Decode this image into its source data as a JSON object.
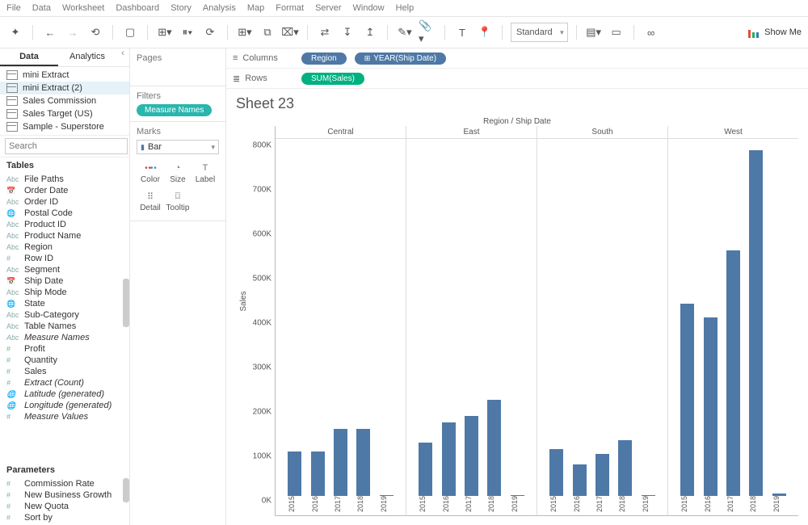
{
  "menu": [
    "File",
    "Data",
    "Worksheet",
    "Dashboard",
    "Story",
    "Analysis",
    "Map",
    "Format",
    "Server",
    "Window",
    "Help"
  ],
  "toolbar": {
    "fit": "Standard",
    "showme": "Show Me"
  },
  "left": {
    "tabs": {
      "data": "Data",
      "analytics": "Analytics"
    },
    "datasources": [
      "mini Extract",
      "mini Extract (2)",
      "Sales Commission",
      "Sales Target (US)",
      "Sample - Superstore"
    ],
    "search_placeholder": "Search",
    "tables_header": "Tables",
    "fields": [
      {
        "t": "Abc",
        "n": "File Paths"
      },
      {
        "t": "📅",
        "n": "Order Date"
      },
      {
        "t": "Abc",
        "n": "Order ID"
      },
      {
        "t": "🌐",
        "n": "Postal Code"
      },
      {
        "t": "Abc",
        "n": "Product ID"
      },
      {
        "t": "Abc",
        "n": "Product Name"
      },
      {
        "t": "Abc",
        "n": "Region"
      },
      {
        "t": "#",
        "n": "Row ID"
      },
      {
        "t": "Abc",
        "n": "Segment"
      },
      {
        "t": "📅",
        "n": "Ship Date"
      },
      {
        "t": "Abc",
        "n": "Ship Mode"
      },
      {
        "t": "🌐",
        "n": "State"
      },
      {
        "t": "Abc",
        "n": "Sub-Category"
      },
      {
        "t": "Abc",
        "n": "Table Names"
      },
      {
        "t": "Abc",
        "n": "Measure Names",
        "i": true
      },
      {
        "t": "#",
        "n": "Profit",
        "m": true
      },
      {
        "t": "#",
        "n": "Quantity",
        "m": true
      },
      {
        "t": "#",
        "n": "Sales",
        "m": true
      },
      {
        "t": "#",
        "n": "Extract (Count)",
        "i": true,
        "m": true
      },
      {
        "t": "🌐",
        "n": "Latitude (generated)",
        "i": true,
        "m": true
      },
      {
        "t": "🌐",
        "n": "Longitude (generated)",
        "i": true,
        "m": true
      },
      {
        "t": "#",
        "n": "Measure Values",
        "i": true,
        "m": true
      }
    ],
    "params_header": "Parameters",
    "params": [
      {
        "t": "#",
        "n": "Commission Rate"
      },
      {
        "t": "#",
        "n": "New Business Growth"
      },
      {
        "t": "#",
        "n": "New Quota"
      },
      {
        "t": "#",
        "n": "Sort by"
      }
    ]
  },
  "cards": {
    "pages": "Pages",
    "filters": "Filters",
    "filter_pill": "Measure Names",
    "marks": "Marks",
    "mark_type": "Bar",
    "cells": {
      "color": "Color",
      "size": "Size",
      "label": "Label",
      "detail": "Detail",
      "tooltip": "Tooltip"
    }
  },
  "shelves": {
    "columns_label": "Columns",
    "rows_label": "Rows",
    "col_region": "Region",
    "col_year": "YEAR(Ship Date)",
    "row_sum": "SUM(Sales)"
  },
  "sheet": {
    "title": "Sheet 23",
    "axis_top": "Region / Ship Date",
    "ylabel": "Sales"
  },
  "chart_data": {
    "type": "bar",
    "title": "Sheet 23",
    "xlabel": "Region / Ship Date",
    "ylabel": "Sales",
    "ylim": [
      0,
      800000
    ],
    "yticks": [
      "0K",
      "100K",
      "200K",
      "300K",
      "400K",
      "500K",
      "600K",
      "700K",
      "800K"
    ],
    "categories": [
      "2015",
      "2016",
      "2017",
      "2018",
      "2019"
    ],
    "series": [
      {
        "name": "Central",
        "values": [
          100000,
          100000,
          150000,
          150000,
          2000
        ]
      },
      {
        "name": "East",
        "values": [
          120000,
          165000,
          180000,
          215000,
          2000
        ]
      },
      {
        "name": "South",
        "values": [
          105000,
          70000,
          95000,
          125000,
          2000
        ]
      },
      {
        "name": "West",
        "values": [
          430000,
          400000,
          550000,
          775000,
          5000
        ]
      }
    ]
  }
}
